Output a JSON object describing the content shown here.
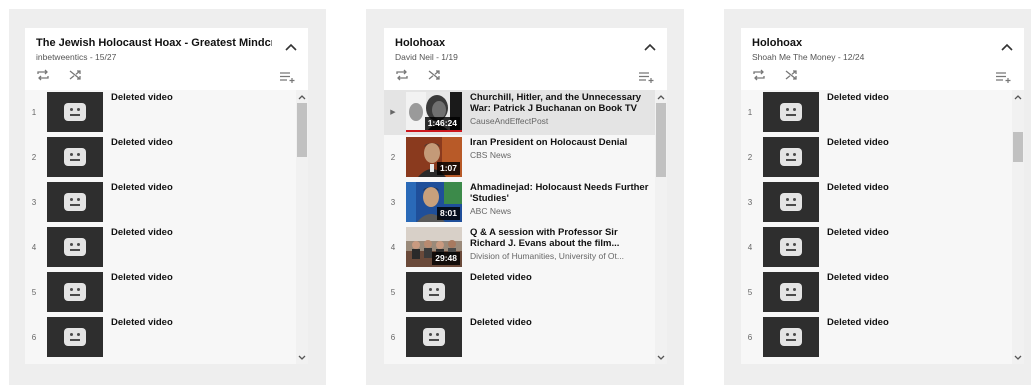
{
  "panels": [
    {
      "title": "The Jewish Holocaust Hoax - Greatest Mindcrime of t",
      "subtitle": "inbetweentics - 15/27",
      "items": [
        {
          "index": "1",
          "title": "Deleted video"
        },
        {
          "index": "2",
          "title": "Deleted video"
        },
        {
          "index": "3",
          "title": "Deleted video"
        },
        {
          "index": "4",
          "title": "Deleted video"
        },
        {
          "index": "5",
          "title": "Deleted video"
        },
        {
          "index": "6",
          "title": "Deleted video"
        }
      ]
    },
    {
      "title": "Holohoax",
      "subtitle": "David Neil - 1/19",
      "items": [
        {
          "index": "▶",
          "title": "Churchill, Hitler, and the Unnecessary War: Patrick J Buchanan on Book TV",
          "channel": "CauseAndEffectPost",
          "duration": "1:46:24"
        },
        {
          "index": "2",
          "title": "Iran President on Holocaust Denial",
          "channel": "CBS News",
          "duration": "1:07"
        },
        {
          "index": "3",
          "title": "Ahmadinejad: Holocaust Needs Further 'Studies'",
          "channel": "ABC News",
          "duration": "8:01"
        },
        {
          "index": "4",
          "title": "Q & A session with Professor Sir Richard J. Evans about the film...",
          "channel": "Division of Humanities, University of Ot...",
          "duration": "29:48"
        },
        {
          "index": "5",
          "title": "Deleted video"
        },
        {
          "index": "6",
          "title": "Deleted video"
        }
      ]
    },
    {
      "title": "Holohoax",
      "subtitle": "Shoah Me The Money - 12/24",
      "items": [
        {
          "index": "1",
          "title": "Deleted video"
        },
        {
          "index": "2",
          "title": "Deleted video"
        },
        {
          "index": "3",
          "title": "Deleted video"
        },
        {
          "index": "4",
          "title": "Deleted video"
        },
        {
          "index": "5",
          "title": "Deleted video"
        },
        {
          "index": "6",
          "title": "Deleted video"
        }
      ]
    }
  ],
  "icons": {
    "collapse": "chevron-up-icon",
    "loop": "loop-icon",
    "shuffle": "shuffle-icon",
    "add_to_queue": "add-to-queue-icon",
    "deleted_thumb": "deleted-video-icon",
    "scroll_up": "scroll-up-icon",
    "scroll_down": "scroll-down-icon"
  },
  "colors": {
    "progress": "#cc181e",
    "panel_bg": "#eeeeee",
    "list_bg": "#f7f7f7",
    "active_row": "#e4e4e4"
  }
}
